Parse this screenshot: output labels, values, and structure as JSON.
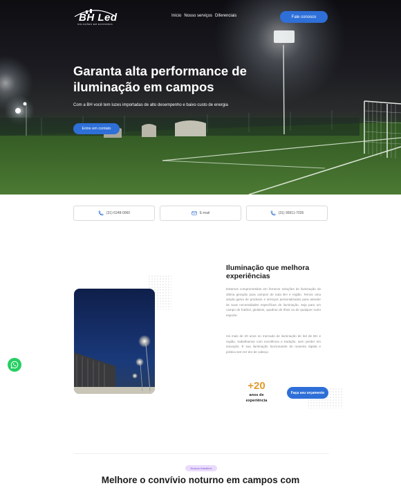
{
  "header": {
    "logo_text": "BH Led",
    "logo_tagline": "SOLUÇÕES EM ECONOMIA",
    "nav": [
      "Início",
      "Nosso serviços",
      "Diferenciais"
    ],
    "cta_label": "Fale conosco"
  },
  "hero": {
    "title": "Garanta alta performance de iluminação em campos",
    "subtitle": "Com a BH você tem luzes importadas de alto desempenho e baixo custo de energia",
    "cta_label": "Entre em contato"
  },
  "contacts": [
    {
      "icon": "phone-icon",
      "label": "(31) 6248-0060"
    },
    {
      "icon": "mail-icon",
      "label": "E-mail"
    },
    {
      "icon": "phone-icon",
      "label": "(31) 99911-7026"
    }
  ],
  "about": {
    "title": "Iluminação que melhora experiências",
    "paragraph1": "Estamos comprometidos em fornecer soluções de iluminação de última geração para campos de toda BH e região. Temos uma ampla gama de produtos e serviços personalizados para atender às suas necessidades específicas de iluminação, seja para um campo de futebol, ginásios, quadras de tênis ou de qualquer outro esporte.",
    "paragraph2": "Há mais de 20 anos no mercado de iluminação de led de BH e região, trabalhamos com excelência e tradição, sem perder em inovação. É sua iluminação funcionando de maneira rápida e prática sem ter dor de cabeça",
    "stat_number": "+20",
    "stat_label": "anos de experiência",
    "cta_label": "Faça seu orçamento"
  },
  "works": {
    "badge": "Nossos trabalhos",
    "title": "Melhore o convívio noturno em campos com"
  },
  "colors": {
    "accent": "#2e6fd8",
    "stat": "#e39a2d",
    "whatsapp": "#26cf62",
    "badge_bg": "#e9dcfb"
  }
}
